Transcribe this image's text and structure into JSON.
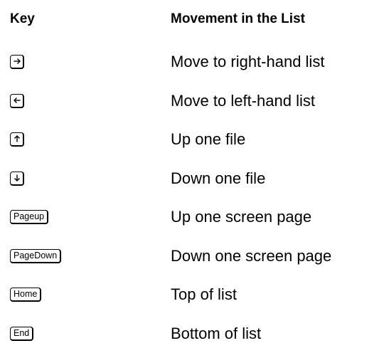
{
  "header": {
    "key_label": "Key",
    "movement_label": "Movement in the List"
  },
  "rows": [
    {
      "key_icon": "right-arrow-key-icon",
      "key_text": "",
      "movement": "Move to right-hand list"
    },
    {
      "key_icon": "left-arrow-key-icon",
      "key_text": "",
      "movement": "Move to left-hand list"
    },
    {
      "key_icon": "up-arrow-key-icon",
      "key_text": "",
      "movement": "Up one file"
    },
    {
      "key_icon": "down-arrow-key-icon",
      "key_text": "",
      "movement": "Down one file"
    },
    {
      "key_icon": "",
      "key_text": "Pageup",
      "movement": "Up one screen page"
    },
    {
      "key_icon": "",
      "key_text": "PageDown",
      "movement": "Down one screen page"
    },
    {
      "key_icon": "",
      "key_text": "Home",
      "movement": "Top of list"
    },
    {
      "key_icon": "",
      "key_text": "End",
      "movement": "Bottom of list"
    }
  ]
}
